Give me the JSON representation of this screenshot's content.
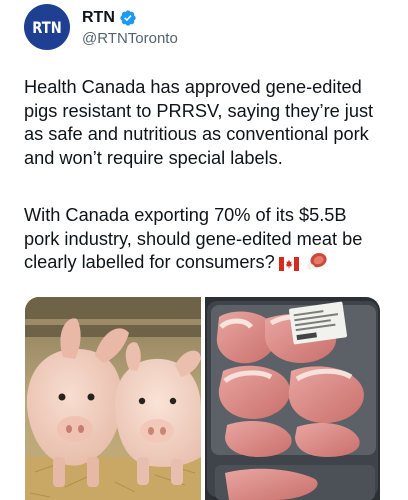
{
  "author": {
    "avatar_text": "RTN",
    "display_name": "RTN",
    "handle": "@RTNToronto",
    "verified_icon": "verified-badge-icon"
  },
  "tweet": {
    "paragraph_1": "Health Canada has approved gene-edited\npigs resistant to PRRSV, saying they’re just\nas safe and nutritious as conventional pork\nand won’t require special labels.",
    "paragraph_2": "With Canada exporting 70% of its $5.5B\npork industry, should gene-edited meat be\nclearly labelled for consumers?",
    "emojis": [
      "canada-flag-icon",
      "meat-icon"
    ]
  },
  "media": {
    "items": [
      {
        "name": "photo-pigs-in-barn"
      },
      {
        "name": "photo-packaged-pork-chops"
      }
    ]
  },
  "colors": {
    "avatar_bg": "#1f3f93",
    "verified": "#1d9bf0",
    "text": "#0f1419",
    "secondary": "#536471"
  }
}
